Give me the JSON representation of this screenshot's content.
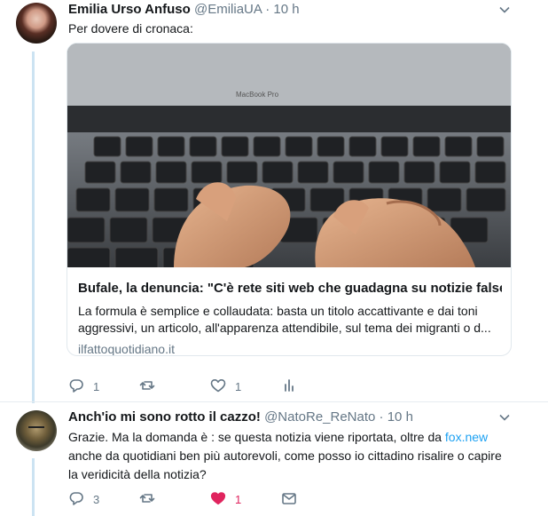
{
  "tweet1": {
    "name": "Emilia Urso Anfuso",
    "handle": "@EmiliaUA",
    "separator": "·",
    "time": "10 h",
    "text": "Per dovere di cronaca:",
    "card": {
      "image_text": "MacBook Pro",
      "title": "Bufale, la denuncia: \"C'è rete siti web che guadagna su notizie false ...",
      "description": "La formula è semplice e collaudata: basta un titolo accattivante e dai toni aggressivi, un articolo, all'apparenza attendibile, sul tema dei migranti o d...",
      "domain": "ilfattoquotidiano.it"
    },
    "actions": {
      "reply_count": "1",
      "retweet_count": "",
      "like_count": "1"
    }
  },
  "tweet2": {
    "name": "Anch'io mi sono rotto il cazzo!",
    "handle": "@NatoRe_ReNato",
    "separator": "·",
    "time": "10 h",
    "text_before_link": "Grazie. Ma la domanda è : se questa notizia viene riportata, oltre da ",
    "link_text": "fox.new",
    "text_after_link": " anche da quotidiani ben più autorevoli, come posso io cittadino risalire o capire la veridicità della notizia?",
    "actions": {
      "reply_count": "3",
      "retweet_count": "",
      "like_count": "1"
    }
  },
  "colors": {
    "accent": "#1da1f2",
    "thread_line": "#cce3f2",
    "muted": "#657786",
    "like_active": "#e0245e"
  },
  "icons": [
    "caret-down-icon",
    "reply-icon",
    "retweet-icon",
    "like-icon",
    "analytics-icon",
    "message-icon"
  ]
}
